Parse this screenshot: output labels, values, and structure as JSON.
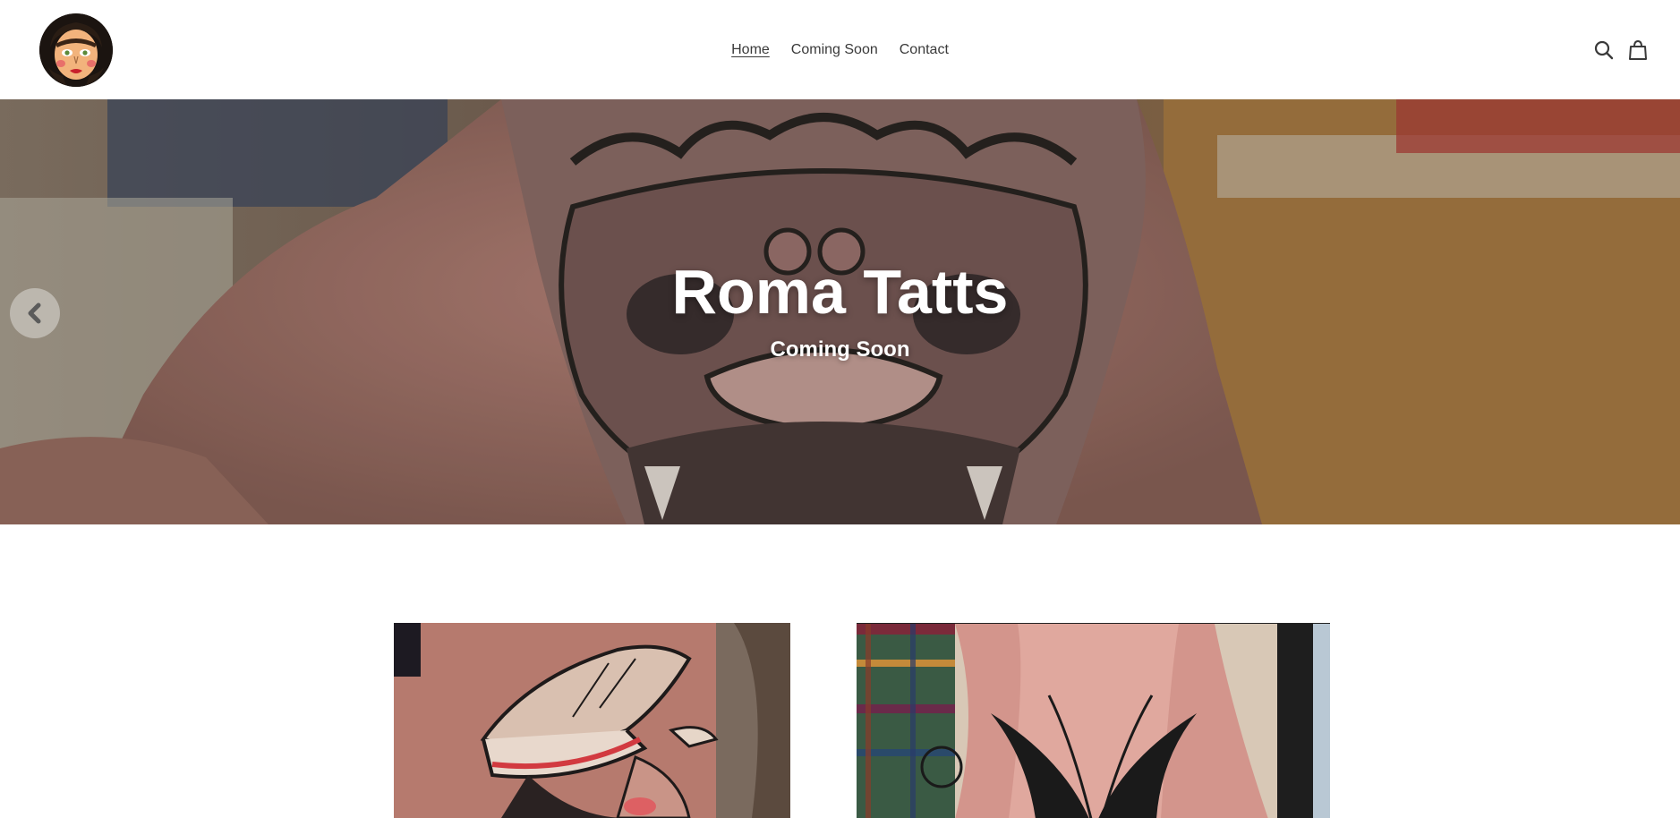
{
  "header": {
    "logo_alt": "Roma Tatts logo",
    "nav": [
      {
        "label": "Home",
        "active": true
      },
      {
        "label": "Coming Soon",
        "active": false
      },
      {
        "label": "Contact",
        "active": false
      }
    ],
    "icons": [
      "search-icon",
      "cart-icon"
    ]
  },
  "hero": {
    "title": "Roma Tatts",
    "subtitle": "Coming Soon",
    "prev_icon": "chevron-left-icon"
  },
  "gallery": [
    {
      "name": "sailor-girl-tattoo-image"
    },
    {
      "name": "butterfly-leg-tattoo-image"
    }
  ],
  "colors": {
    "text": "#3a3a3a",
    "hero_text": "#ffffff",
    "skin": "#b08070",
    "ink": "#2a2522"
  }
}
